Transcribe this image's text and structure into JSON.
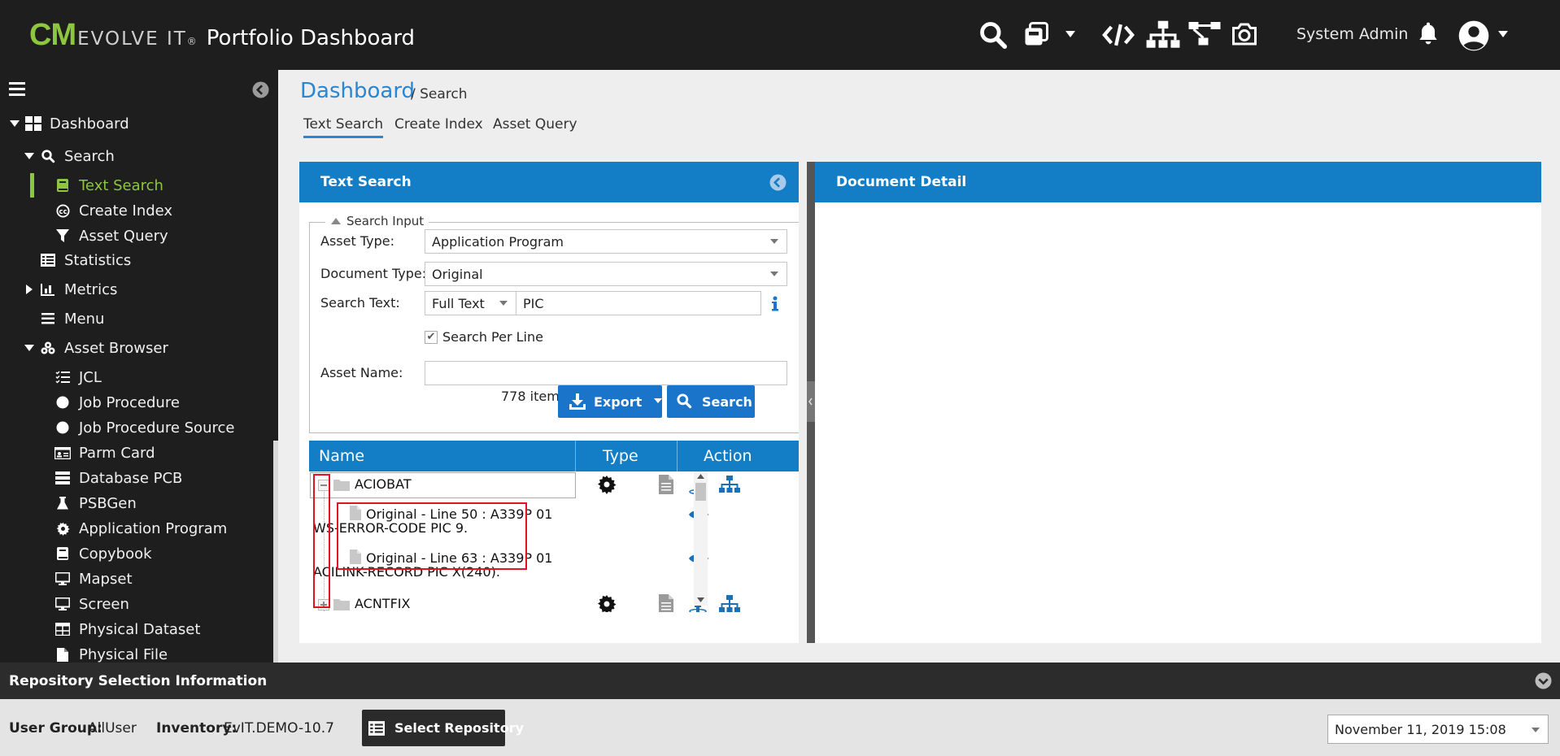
{
  "header": {
    "brand_cm": "CM",
    "brand_evolve": "EVOLVE IT",
    "brand_reg": "®",
    "app_title": "Portfolio Dashboard",
    "user_name": "System Admin",
    "icons": [
      "search-icon",
      "copy-icon",
      "chevron-down-icon",
      "code-icon",
      "sitemap-icon",
      "flow-icon",
      "camera-icon",
      "bell-icon",
      "user-avatar-icon"
    ]
  },
  "sidebar": {
    "items": [
      {
        "label": "Dashboard",
        "icon": "dashboard-icon"
      },
      {
        "label": "Search",
        "icon": "search-icon"
      },
      {
        "label": "Text Search",
        "icon": "book-icon"
      },
      {
        "label": "Create Index",
        "icon": "copyright-icon"
      },
      {
        "label": "Asset Query",
        "icon": "filter-icon"
      },
      {
        "label": "Statistics",
        "icon": "list-icon"
      },
      {
        "label": "Metrics",
        "icon": "chart-icon"
      },
      {
        "label": "Menu",
        "icon": "menu-icon"
      },
      {
        "label": "Asset Browser",
        "icon": "cubes-icon"
      },
      {
        "label": "JCL",
        "icon": "tasks-icon"
      },
      {
        "label": "Job Procedure",
        "icon": "circle-icon"
      },
      {
        "label": "Job Procedure Source",
        "icon": "circle-icon"
      },
      {
        "label": "Parm Card",
        "icon": "id-card-icon"
      },
      {
        "label": "Database PCB",
        "icon": "server-icon"
      },
      {
        "label": "PSBGen",
        "icon": "flask-icon"
      },
      {
        "label": "Application Program",
        "icon": "gear-icon"
      },
      {
        "label": "Copybook",
        "icon": "book-icon"
      },
      {
        "label": "Mapset",
        "icon": "desktop-icon"
      },
      {
        "label": "Screen",
        "icon": "desktop-icon"
      },
      {
        "label": "Physical Dataset",
        "icon": "table-icon"
      },
      {
        "label": "Physical File",
        "icon": "file-icon"
      }
    ]
  },
  "breadcrumb": {
    "title": "Dashboard",
    "sub": "/ Search"
  },
  "tabs": [
    "Text Search",
    "Create Index",
    "Asset Query"
  ],
  "text_search": {
    "panel_title": "Text Search",
    "legend": "Search Input",
    "asset_type_label": "Asset Type:",
    "asset_type_value": "Application Program",
    "document_type_label": "Document Type:",
    "document_type_value": "Original",
    "search_text_label": "Search Text:",
    "search_mode_value": "Full Text",
    "search_text_value": "PIC",
    "search_per_line_label": "Search Per Line",
    "search_per_line_checked": true,
    "asset_name_label": "Asset Name:",
    "asset_name_value": "",
    "items_count": "778 items",
    "export_label": "Export",
    "search_label": "Search"
  },
  "results": {
    "columns": [
      "Name",
      "Type",
      "Action"
    ],
    "rows": [
      {
        "kind": "folder",
        "name": "ACIOBAT",
        "type_icon": "gear-icon",
        "actions": [
          "file-icon",
          "person-icon",
          "sitemap-icon"
        ]
      },
      {
        "kind": "match",
        "line1": "Original - Line 50 : A339P 01",
        "line2": "WS-ERROR-CODE PIC 9.",
        "actions": [
          "eye-icon"
        ]
      },
      {
        "kind": "match",
        "line1": "Original - Line 63 : A339P 01",
        "line2": "ACILINK-RECORD PIC X(240).",
        "actions": [
          "eye-icon"
        ]
      },
      {
        "kind": "folder",
        "name": "ACNTFIX",
        "type_icon": "gear-icon",
        "actions": [
          "file-icon",
          "person-icon",
          "sitemap-icon"
        ]
      }
    ]
  },
  "document_detail": {
    "panel_title": "Document Detail"
  },
  "footer": {
    "repo_title": "Repository Selection Information",
    "user_group_label": "User Group:",
    "user_group_value": "AllUser",
    "inventory_label": "Inventory:",
    "inventory_value": "EvIT.DEMO-10.7",
    "select_repo_label": "Select Repository",
    "datetime": "November 11, 2019 15:08"
  },
  "colors": {
    "topbar": "#1e1e1e",
    "brand_green": "#8dc63f",
    "panel_header": "#137dc5",
    "button_blue": "#1a74c9",
    "link_blue": "#2b86d1",
    "highlight_red": "#e0141e"
  }
}
